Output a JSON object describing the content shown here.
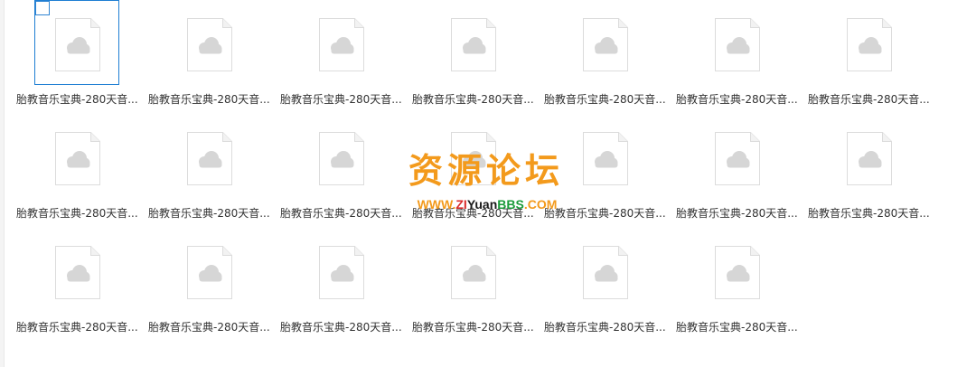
{
  "files": [
    {
      "name": "胎教音乐宝典-280天音..."
    },
    {
      "name": "胎教音乐宝典-280天音..."
    },
    {
      "name": "胎教音乐宝典-280天音..."
    },
    {
      "name": "胎教音乐宝典-280天音..."
    },
    {
      "name": "胎教音乐宝典-280天音..."
    },
    {
      "name": "胎教音乐宝典-280天音..."
    },
    {
      "name": "胎教音乐宝典-280天音..."
    },
    {
      "name": "胎教音乐宝典-280天音..."
    },
    {
      "name": "胎教音乐宝典-280天音..."
    },
    {
      "name": "胎教音乐宝典-280天音..."
    },
    {
      "name": "胎教音乐宝典-280天音..."
    },
    {
      "name": "胎教音乐宝典-280天音..."
    },
    {
      "name": "胎教音乐宝典-280天音..."
    },
    {
      "name": "胎教音乐宝典-280天音..."
    },
    {
      "name": "胎教音乐宝典-280天音..."
    },
    {
      "name": "胎教音乐宝典-280天音..."
    },
    {
      "name": "胎教音乐宝典-280天音..."
    },
    {
      "name": "胎教音乐宝典-280天音..."
    },
    {
      "name": "胎教音乐宝典-280天音..."
    },
    {
      "name": "胎教音乐宝典-280天音..."
    }
  ],
  "selected_index": 0,
  "file_icon": "cloud-file-icon",
  "watermark": {
    "title": "资源论坛",
    "www": "WWW.",
    "zi": "ZI",
    "yuan": "Yuan",
    "bbs": "BBS",
    "com": ".COM"
  },
  "colors": {
    "selection": "#1e7ed3",
    "checkbox_border": "#2f84d3",
    "file_name": "#333333",
    "watermark_orange": "#f39a1c",
    "watermark_red": "#d92b2b",
    "watermark_green": "#1b9b3a"
  }
}
